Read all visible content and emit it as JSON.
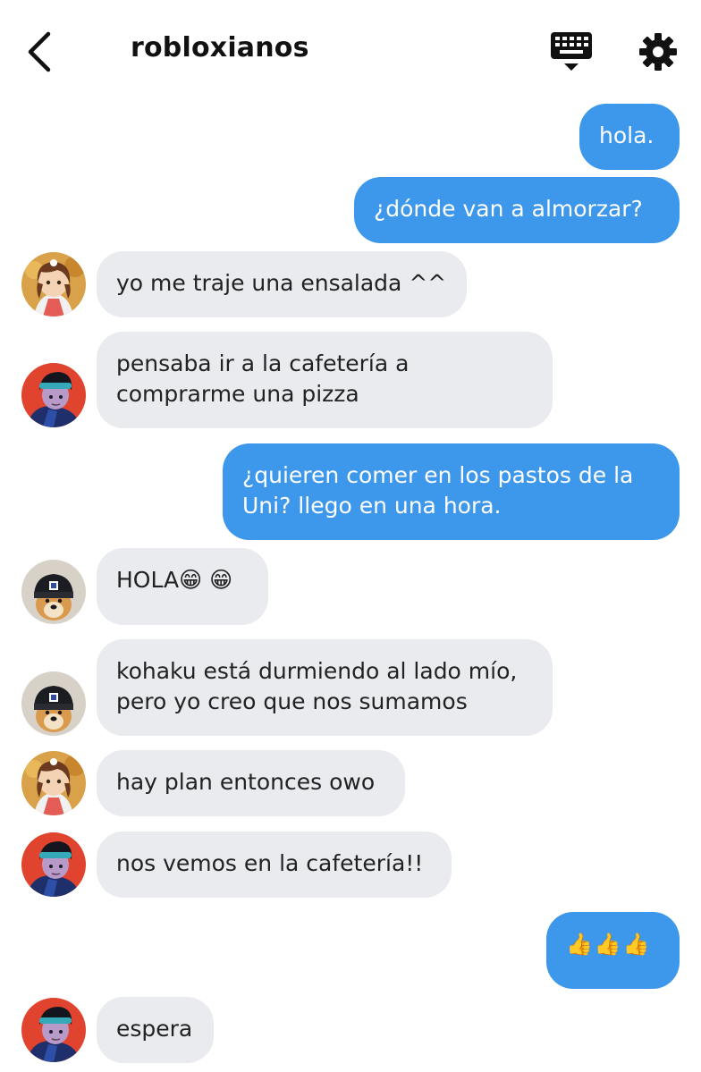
{
  "header": {
    "title": "robloxianos",
    "back_icon": "chevron-left-icon",
    "keyboard_icon": "keyboard-icon",
    "settings_icon": "gear-icon"
  },
  "colors": {
    "outgoing_bubble": "#3d97ea",
    "incoming_bubble": "#e9ebef"
  },
  "messages": [
    {
      "direction": "out",
      "lines": [
        "hola."
      ]
    },
    {
      "direction": "out",
      "lines": [
        "¿dónde van a almorzar?"
      ]
    },
    {
      "direction": "in",
      "sender_avatar": "avatar-girl-brown-hair",
      "lines": [
        "yo me traje una ensalada ^^"
      ]
    },
    {
      "direction": "in",
      "sender_avatar": "avatar-boy-headband",
      "lines": [
        "pensaba ir a la cafetería a",
        "comprarme una pizza"
      ]
    },
    {
      "direction": "out",
      "lines": [
        "¿quieren comer en los pastos de la",
        "Uni? llego en una hora."
      ]
    },
    {
      "direction": "in",
      "sender_avatar": "avatar-dog-beanie",
      "lines": [
        "HOLA😁 😁"
      ]
    },
    {
      "direction": "in",
      "sender_avatar": "avatar-dog-beanie",
      "lines": [
        "kohaku está durmiendo al lado mío,",
        "pero yo creo que nos sumamos"
      ]
    },
    {
      "direction": "in",
      "sender_avatar": "avatar-girl-brown-hair",
      "lines": [
        "hay plan entonces owo"
      ]
    },
    {
      "direction": "in",
      "sender_avatar": "avatar-boy-headband",
      "lines": [
        "nos vemos en la cafetería!!"
      ]
    },
    {
      "direction": "out",
      "lines": [
        "👍👍👍"
      ]
    },
    {
      "direction": "in",
      "sender_avatar": "avatar-boy-headband",
      "lines": [
        "espera"
      ]
    }
  ]
}
